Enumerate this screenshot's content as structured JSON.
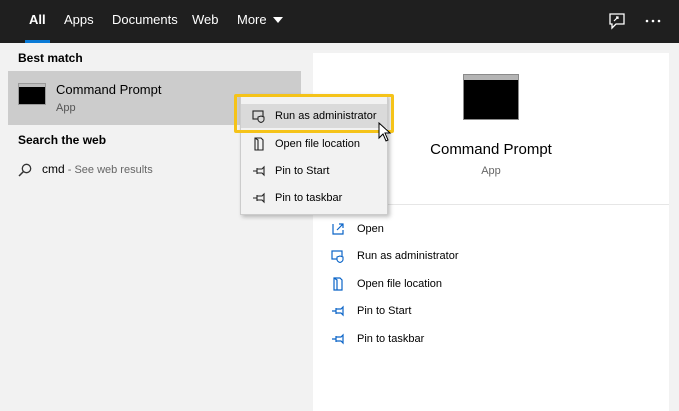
{
  "tabs": [
    {
      "label": "All",
      "active": true
    },
    {
      "label": "Apps"
    },
    {
      "label": "Documents"
    },
    {
      "label": "Web"
    },
    {
      "label": "More"
    }
  ],
  "top_icons": [
    "feedback-icon",
    "more-options-icon"
  ],
  "best_match": {
    "section_label": "Best match",
    "title": "Command Prompt",
    "subtitle": "App"
  },
  "search_web": {
    "section_label": "Search the web",
    "query": "cmd",
    "hint": " - See web results"
  },
  "context_menu": {
    "items": [
      {
        "label": "Run as administrator",
        "icon": "shield-icon",
        "hovered": true
      },
      {
        "label": "Open file location",
        "icon": "folder-location-icon"
      },
      {
        "label": "Pin to Start",
        "icon": "pin-icon"
      },
      {
        "label": "Pin to taskbar",
        "icon": "pin-icon"
      }
    ],
    "highlight_color": "#f5c319"
  },
  "detail": {
    "title": "Command Prompt",
    "subtitle": "App",
    "actions": [
      {
        "label": "Open",
        "icon": "open-icon"
      },
      {
        "label": "Run as administrator",
        "icon": "shield-icon"
      },
      {
        "label": "Open file location",
        "icon": "folder-location-icon"
      },
      {
        "label": "Pin to Start",
        "icon": "pin-icon"
      },
      {
        "label": "Pin to taskbar",
        "icon": "pin-icon"
      }
    ]
  },
  "colors": {
    "topbar_bg": "#1f1f1f",
    "accent": "#0a7ad6",
    "action_icon": "#0a64c8",
    "selection_bg": "#cccccc"
  }
}
